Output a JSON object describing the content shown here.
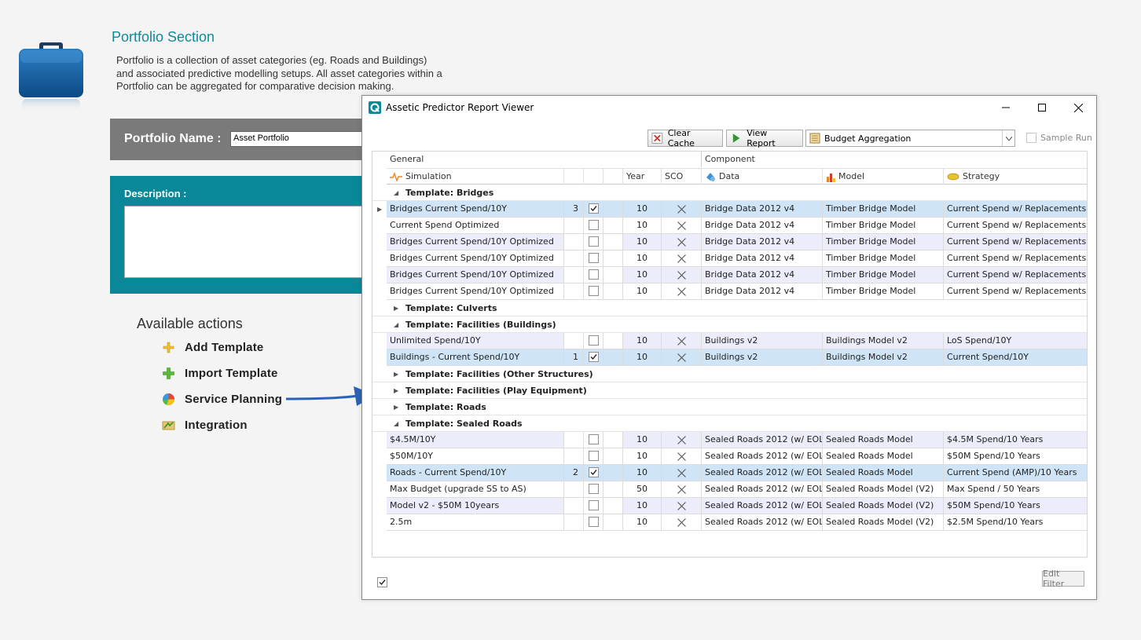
{
  "portfolio": {
    "title": "Portfolio Section",
    "description_lines": [
      "Portfolio is a collection of asset categories (eg. Roads and Buildings)",
      "and associated predictive modelling setups. All asset categories within a",
      "Portfolio can be aggregated for comparative decision making."
    ],
    "name_label": "Portfolio Name :",
    "name_value": "Asset Portfolio",
    "description_label": "Description :"
  },
  "actions": {
    "title": "Available actions",
    "items": [
      {
        "label": "Add Template",
        "icon": "plus-icon"
      },
      {
        "label": "Import Template",
        "icon": "green-plus-icon"
      },
      {
        "label": "Service Planning",
        "icon": "pie-chart-icon"
      },
      {
        "label": "Integration",
        "icon": "integration-icon"
      }
    ]
  },
  "dialog": {
    "title": "Assetic Predictor Report Viewer",
    "toolbar": {
      "clear_cache": "Clear Cache",
      "view_report": "View Report",
      "report_select": "Budget Aggregation",
      "sample_run": "Sample Run"
    },
    "bands": {
      "general": "General",
      "component": "Component"
    },
    "columns": {
      "simulation": "Simulation",
      "year": "Year",
      "sco": "SCO",
      "data": "Data",
      "model": "Model",
      "strategy": "Strategy"
    },
    "edit_filter": "Edit Filter",
    "rows": [
      {
        "type": "group",
        "label": "Template: Bridges",
        "expanded": true
      },
      {
        "type": "data",
        "sim": "Bridges Current Spend/10Y",
        "n": "3",
        "checked": true,
        "year": "10",
        "data": "Bridge Data 2012 v4",
        "model": "Timber Bridge Model",
        "strategy": "Current Spend w/ Replacements",
        "selected": true,
        "current": true
      },
      {
        "type": "data",
        "sim": "Current Spend Optimized",
        "n": "",
        "checked": false,
        "year": "10",
        "data": "Bridge Data 2012 v4",
        "model": "Timber Bridge Model",
        "strategy": "Current Spend w/ Replacements ..."
      },
      {
        "type": "data",
        "sim": "Bridges Current Spend/10Y Optimized",
        "n": "",
        "checked": false,
        "year": "10",
        "data": "Bridge Data 2012 v4",
        "model": "Timber Bridge Model",
        "strategy": "Current Spend w/ Replacements ..."
      },
      {
        "type": "data",
        "sim": "Bridges Current Spend/10Y Optimized",
        "n": "",
        "checked": false,
        "year": "10",
        "data": "Bridge Data 2012 v4",
        "model": "Timber Bridge Model",
        "strategy": "Current Spend w/ Replacements ..."
      },
      {
        "type": "data",
        "sim": "Bridges Current Spend/10Y Optimized",
        "n": "",
        "checked": false,
        "year": "10",
        "data": "Bridge Data 2012 v4",
        "model": "Timber Bridge Model",
        "strategy": "Current Spend w/ Replacements ..."
      },
      {
        "type": "data",
        "sim": "Bridges Current Spend/10Y Optimized",
        "n": "",
        "checked": false,
        "year": "10",
        "data": "Bridge Data 2012 v4",
        "model": "Timber Bridge Model",
        "strategy": "Current Spend w/ Replacements ..."
      },
      {
        "type": "group",
        "label": "Template: Culverts",
        "expanded": false
      },
      {
        "type": "group",
        "label": "Template: Facilities (Buildings)",
        "expanded": true
      },
      {
        "type": "data",
        "sim": "Unlimited Spend/10Y",
        "n": "",
        "checked": false,
        "year": "10",
        "data": "Buildings v2",
        "model": "Buildings Model v2",
        "strategy": "LoS Spend/10Y"
      },
      {
        "type": "data",
        "sim": "Buildings - Current Spend/10Y",
        "n": "1",
        "checked": true,
        "year": "10",
        "data": "Buildings v2",
        "model": "Buildings Model v2",
        "strategy": "Current Spend/10Y",
        "selected": true
      },
      {
        "type": "group",
        "label": "Template: Facilities (Other Structures)",
        "expanded": false
      },
      {
        "type": "group",
        "label": "Template: Facilities (Play Equipment)",
        "expanded": false
      },
      {
        "type": "group",
        "label": "Template: Roads",
        "expanded": false
      },
      {
        "type": "group",
        "label": "Template: Sealed Roads",
        "expanded": true
      },
      {
        "type": "data",
        "sim": "$4.5M/10Y",
        "n": "",
        "checked": false,
        "year": "10",
        "data": "Sealed Roads 2012 (w/ EOL...",
        "model": "Sealed Roads Model",
        "strategy": "$4.5M Spend/10 Years"
      },
      {
        "type": "data",
        "sim": "$50M/10Y",
        "n": "",
        "checked": false,
        "year": "10",
        "data": "Sealed Roads 2012 (w/ EOL...",
        "model": "Sealed Roads Model",
        "strategy": "$50M Spend/10 Years"
      },
      {
        "type": "data",
        "sim": "Roads - Current Spend/10Y",
        "n": "2",
        "checked": true,
        "year": "10",
        "data": "Sealed Roads 2012 (w/ EOL...",
        "model": "Sealed Roads Model",
        "strategy": "Current Spend (AMP)/10 Years",
        "selected": true
      },
      {
        "type": "data",
        "sim": "Max Budget (upgrade SS to AS)",
        "n": "",
        "checked": false,
        "year": "50",
        "data": "Sealed Roads 2012 (w/ EOL...",
        "model": "Sealed Roads Model (V2)",
        "strategy": "Max Spend / 50 Years"
      },
      {
        "type": "data",
        "sim": "Model v2 - $50M 10years",
        "n": "",
        "checked": false,
        "year": "10",
        "data": "Sealed Roads 2012 (w/ EOL...",
        "model": "Sealed Roads Model (V2)",
        "strategy": "$50M Spend/10 Years"
      },
      {
        "type": "data",
        "sim": "2.5m",
        "n": "",
        "checked": false,
        "year": "10",
        "data": "Sealed Roads 2012 (w/ EOL...",
        "model": "Sealed Roads Model (V2)",
        "strategy": "$2.5M Spend/10 Years"
      }
    ]
  },
  "colors": {
    "teal": "#0a8899",
    "title_teal": "#0f8a9a",
    "band_grey": "#7a7a7a",
    "selected_row": "#cfe4f6",
    "alt_row": "#ececfb",
    "arrow_blue": "#2a63b5"
  }
}
